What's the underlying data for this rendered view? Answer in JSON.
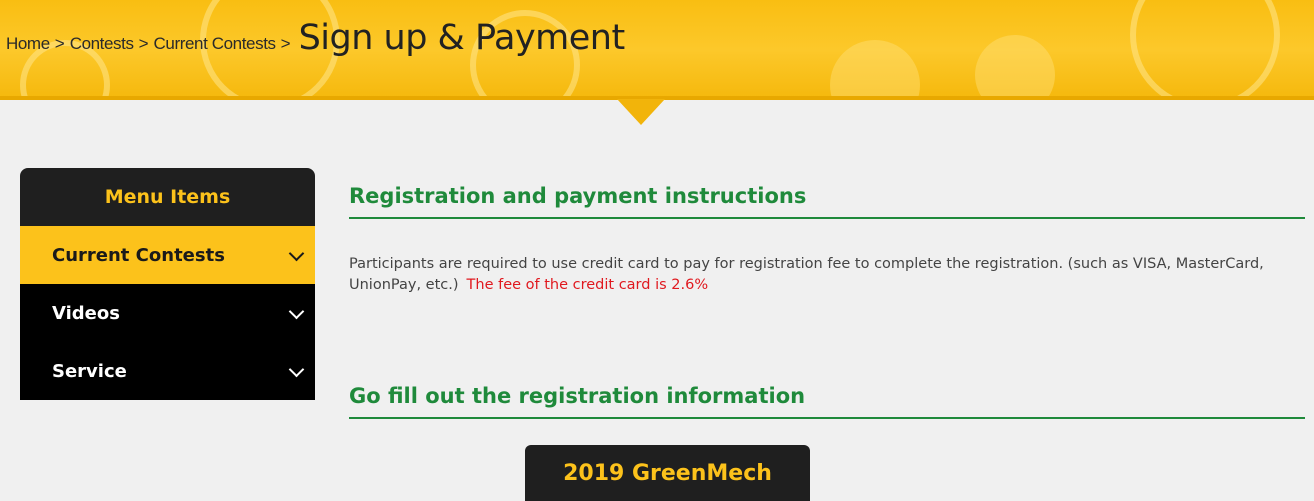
{
  "breadcrumb": {
    "items": [
      "Home",
      "Contests",
      "Current Contests"
    ],
    "separator": ">",
    "title": "Sign up & Payment"
  },
  "sidebar": {
    "heading": "Menu Items",
    "items": [
      {
        "label": "Current Contests",
        "active": true
      },
      {
        "label": "Videos",
        "active": false
      },
      {
        "label": "Service",
        "active": false
      }
    ]
  },
  "main": {
    "section1_title": "Registration and payment instructions",
    "instructions": "Participants are required to use credit card to pay for registration fee to complete the registration. (such as VISA, MasterCard, UnionPay, etc.)",
    "fee_note": "The fee of the credit card is 2.6%",
    "section2_title": "Go fill out the registration information",
    "register_button": "2019 GreenMech"
  },
  "colors": {
    "brand_yellow": "#fcc21b",
    "heading_green": "#1f8a3b",
    "fee_red": "#e0191f",
    "dark": "#1f1f1f"
  }
}
